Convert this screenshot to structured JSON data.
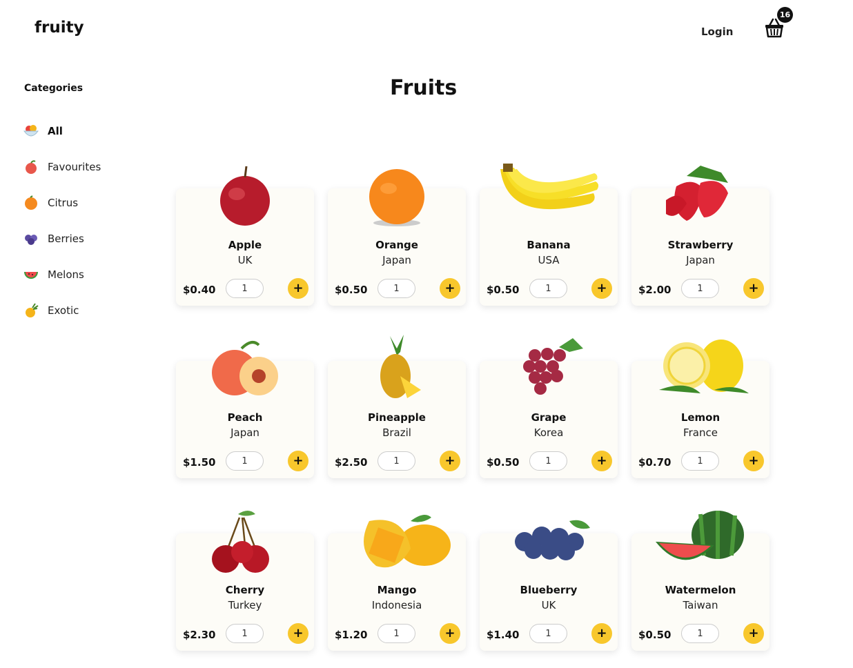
{
  "header": {
    "logo": "fruity",
    "login": "Login",
    "cart_count": "16"
  },
  "sidebar": {
    "title": "Categories",
    "items": [
      {
        "label": "All",
        "icon": "fruit-bowl-icon",
        "active": true
      },
      {
        "label": "Favourites",
        "icon": "apple-icon"
      },
      {
        "label": "Citrus",
        "icon": "orange-icon"
      },
      {
        "label": "Berries",
        "icon": "berries-icon"
      },
      {
        "label": "Melons",
        "icon": "watermelon-icon"
      },
      {
        "label": "Exotic",
        "icon": "pineapple-icon"
      }
    ]
  },
  "main": {
    "title": "Fruits"
  },
  "products": [
    {
      "name": "Apple",
      "origin": "UK",
      "price": "$0.40",
      "qty": "1",
      "icon": "apple"
    },
    {
      "name": "Orange",
      "origin": "Japan",
      "price": "$0.50",
      "qty": "1",
      "icon": "orange"
    },
    {
      "name": "Banana",
      "origin": "USA",
      "price": "$0.50",
      "qty": "1",
      "icon": "banana"
    },
    {
      "name": "Strawberry",
      "origin": "Japan",
      "price": "$2.00",
      "qty": "1",
      "icon": "strawberry"
    },
    {
      "name": "Peach",
      "origin": "Japan",
      "price": "$1.50",
      "qty": "1",
      "icon": "peach"
    },
    {
      "name": "Pineapple",
      "origin": "Brazil",
      "price": "$2.50",
      "qty": "1",
      "icon": "pineapple"
    },
    {
      "name": "Grape",
      "origin": "Korea",
      "price": "$0.50",
      "qty": "1",
      "icon": "grape"
    },
    {
      "name": "Lemon",
      "origin": "France",
      "price": "$0.70",
      "qty": "1",
      "icon": "lemon"
    },
    {
      "name": "Cherry",
      "origin": "Turkey",
      "price": "$2.30",
      "qty": "1",
      "icon": "cherry"
    },
    {
      "name": "Mango",
      "origin": "Indonesia",
      "price": "$1.20",
      "qty": "1",
      "icon": "mango"
    },
    {
      "name": "Blueberry",
      "origin": "UK",
      "price": "$1.40",
      "qty": "1",
      "icon": "blueberry"
    },
    {
      "name": "Watermelon",
      "origin": "Taiwan",
      "price": "$0.50",
      "qty": "1",
      "icon": "watermelon"
    }
  ],
  "add_label": "+",
  "colors": {
    "accent": "#f8c72c",
    "card_bg": "#fdfcf7"
  }
}
